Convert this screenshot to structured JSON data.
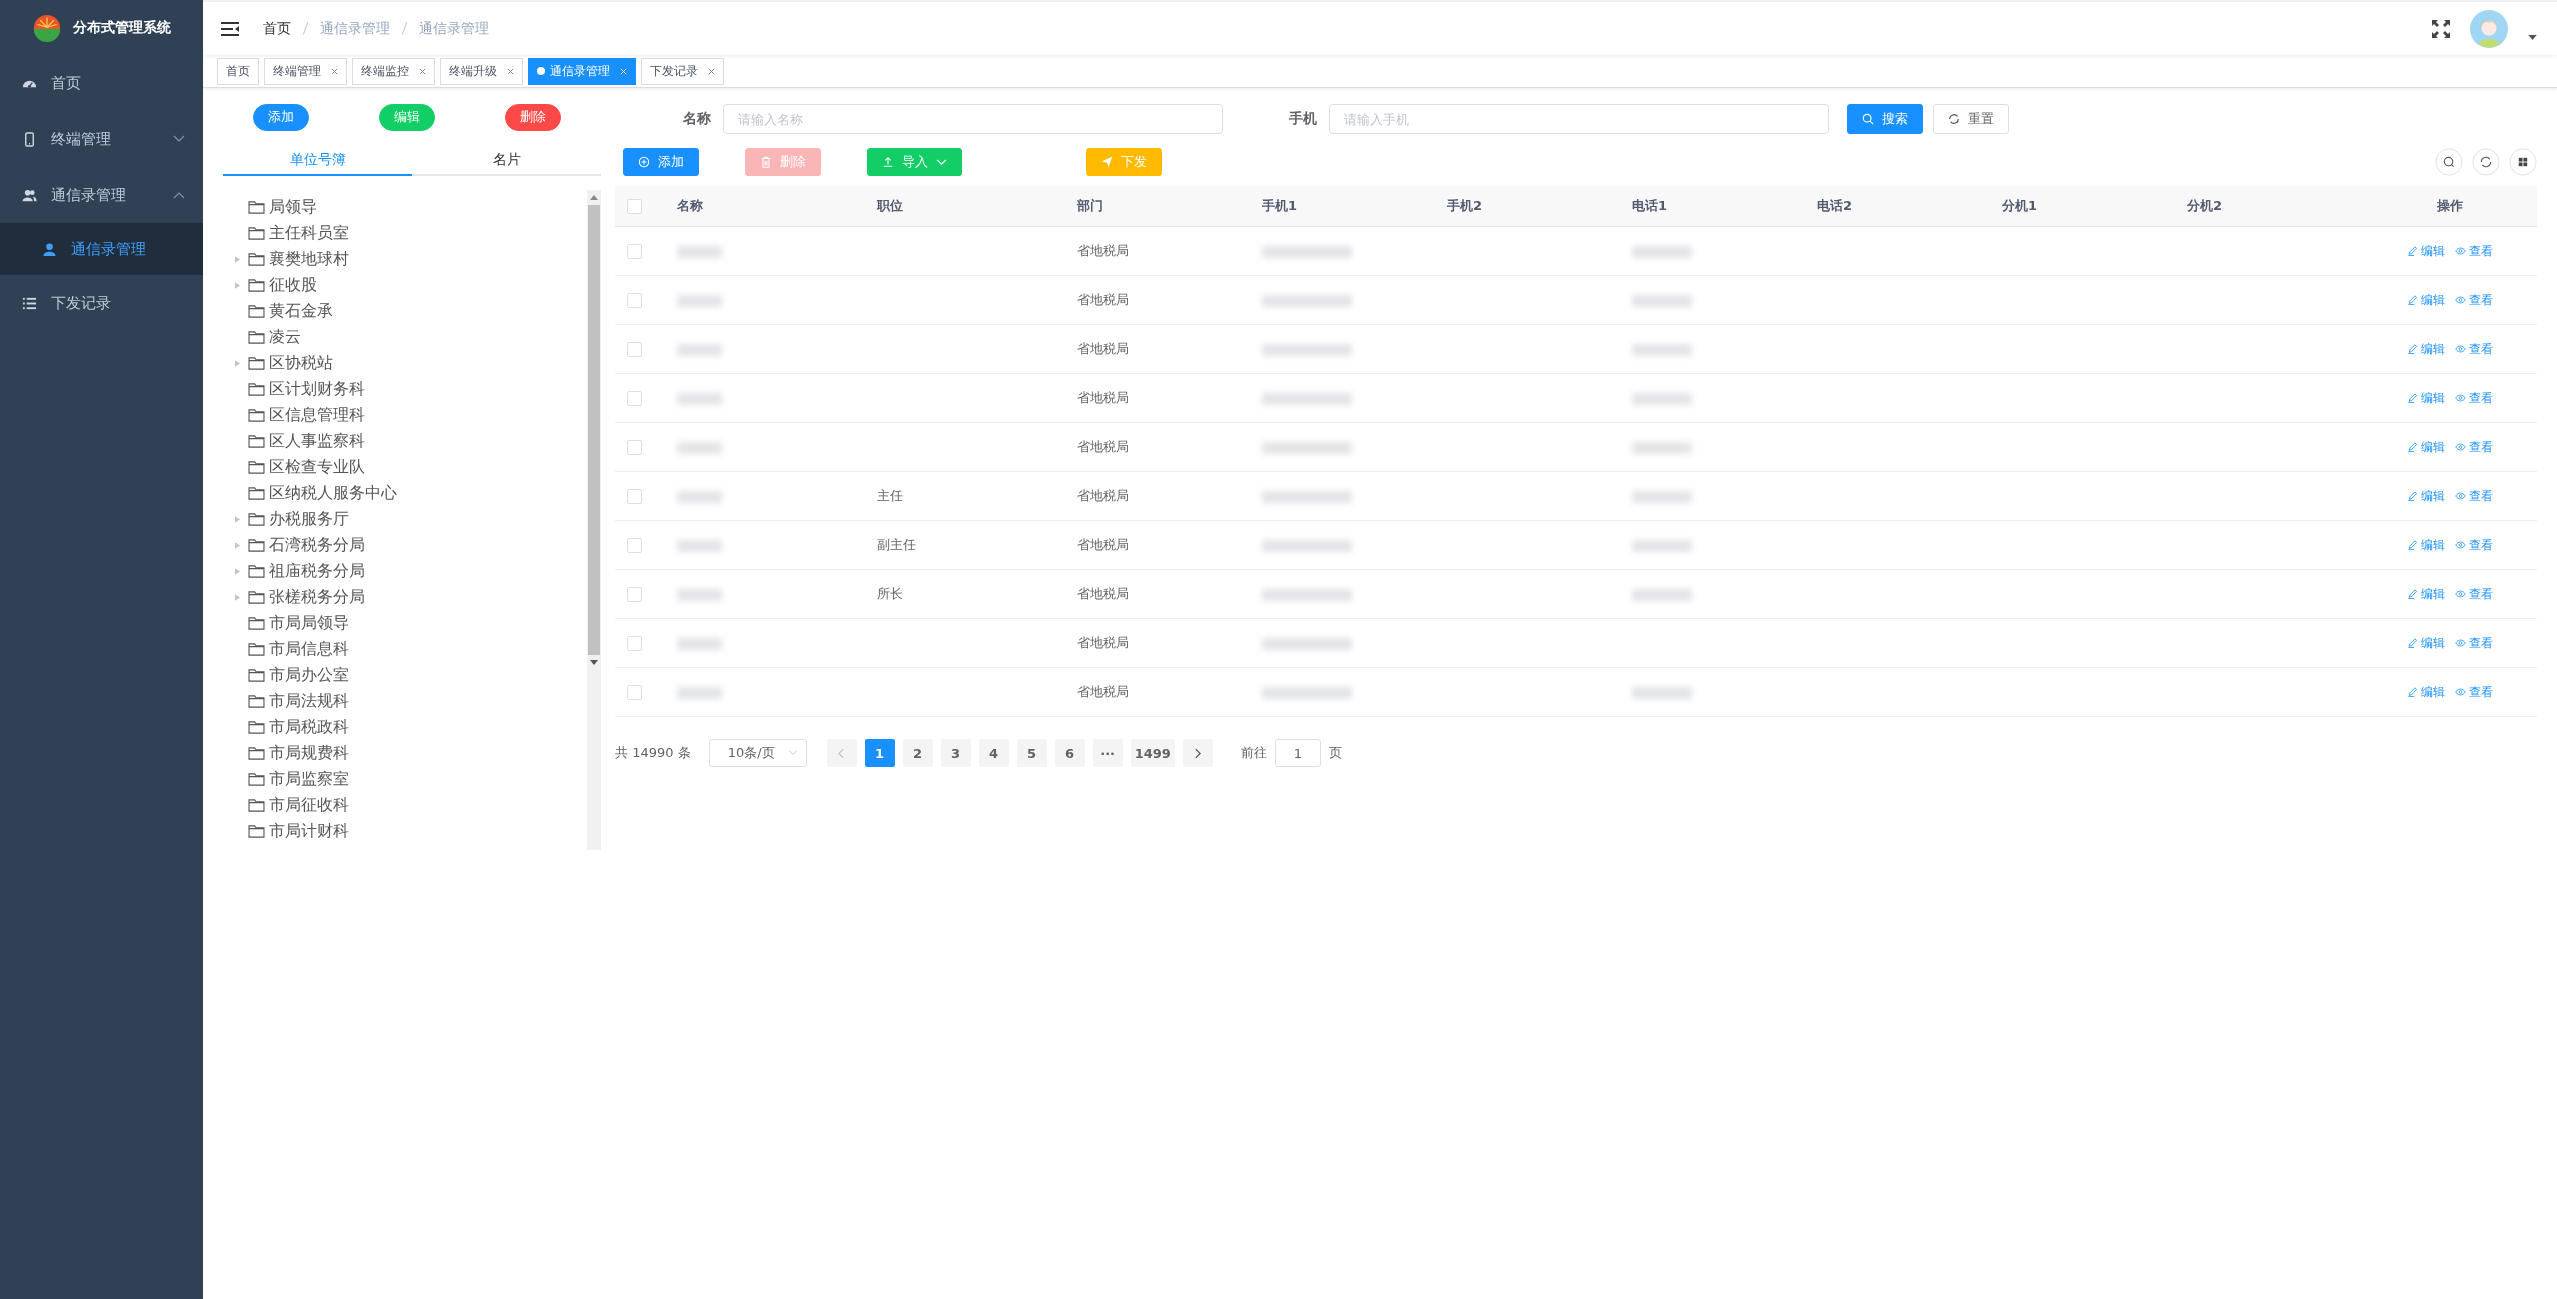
{
  "sidebar": {
    "title": "分布式管理系统",
    "items": [
      {
        "label": "首页",
        "selected": false
      },
      {
        "label": "终端管理",
        "expanded": false,
        "selected": false
      },
      {
        "label": "通信录管理",
        "expanded": true,
        "selected": false,
        "children": [
          {
            "label": "通信录管理",
            "selected": true
          }
        ]
      },
      {
        "label": "下发记录",
        "selected": false
      }
    ]
  },
  "breadcrumb": [
    "首页",
    "通信录管理",
    "通信录管理"
  ],
  "tabs": [
    {
      "label": "首页",
      "selected": false,
      "closable": false
    },
    {
      "label": "终端管理",
      "selected": false,
      "closable": true
    },
    {
      "label": "终端监控",
      "selected": false,
      "closable": true
    },
    {
      "label": "终端升级",
      "selected": false,
      "closable": true
    },
    {
      "label": "通信录管理",
      "selected": true,
      "closable": true
    },
    {
      "label": "下发记录",
      "selected": false,
      "closable": true
    }
  ],
  "left_panel": {
    "buttons": [
      {
        "label": "添加",
        "kind": "primary"
      },
      {
        "label": "编辑",
        "kind": "success"
      },
      {
        "label": "删除",
        "kind": "danger"
      }
    ],
    "tabs": [
      {
        "label": "单位号簿",
        "selected": true
      },
      {
        "label": "名片",
        "selected": false
      }
    ],
    "tree": [
      {
        "label": "局领导",
        "expandable": false
      },
      {
        "label": "主任科员室",
        "expandable": false
      },
      {
        "label": "襄樊地球村",
        "expandable": true
      },
      {
        "label": "征收股",
        "expandable": true
      },
      {
        "label": "黄石金承",
        "expandable": false
      },
      {
        "label": "凌云",
        "expandable": false
      },
      {
        "label": "区协税站",
        "expandable": true
      },
      {
        "label": "区计划财务科",
        "expandable": false
      },
      {
        "label": "区信息管理科",
        "expandable": false
      },
      {
        "label": "区人事监察科",
        "expandable": false
      },
      {
        "label": "区检查专业队",
        "expandable": false
      },
      {
        "label": "区纳税人服务中心",
        "expandable": false
      },
      {
        "label": "办税服务厅",
        "expandable": true
      },
      {
        "label": "石湾税务分局",
        "expandable": true
      },
      {
        "label": "祖庙税务分局",
        "expandable": true
      },
      {
        "label": "张槎税务分局",
        "expandable": true
      },
      {
        "label": "市局局领导",
        "expandable": false
      },
      {
        "label": "市局信息科",
        "expandable": false
      },
      {
        "label": "市局办公室",
        "expandable": false
      },
      {
        "label": "市局法规科",
        "expandable": false
      },
      {
        "label": "市局税政科",
        "expandable": false
      },
      {
        "label": "市局规费科",
        "expandable": false
      },
      {
        "label": "市局监察室",
        "expandable": false
      },
      {
        "label": "市局征收科",
        "expandable": false
      },
      {
        "label": "市局计财科",
        "expandable": false
      }
    ]
  },
  "search": {
    "fields": [
      {
        "label": "名称",
        "placeholder": "请输入名称"
      },
      {
        "label": "手机",
        "placeholder": "请输入手机"
      }
    ],
    "search_button": "搜索",
    "reset_button": "重置"
  },
  "toolbar": [
    {
      "label": "添加",
      "kind": "primary",
      "disabled": false
    },
    {
      "label": "删除",
      "kind": "danger",
      "disabled": true
    },
    {
      "label": "导入",
      "kind": "success",
      "disabled": false
    },
    {
      "label": "下发",
      "kind": "warning",
      "disabled": false
    }
  ],
  "table": {
    "select_all_checked": false,
    "columns": [
      "名称",
      "职位",
      "部门",
      "手机1",
      "手机2",
      "电话1",
      "电话2",
      "分机1",
      "分机2",
      "操作"
    ],
    "rows": [
      {
        "checked": false,
        "position": "",
        "department": "省地税局",
        "has_tel1": true,
        "actions": [
          "编辑",
          "查看"
        ]
      },
      {
        "checked": false,
        "position": "",
        "department": "省地税局",
        "has_tel1": true,
        "actions": [
          "编辑",
          "查看"
        ]
      },
      {
        "checked": false,
        "position": "",
        "department": "省地税局",
        "has_tel1": true,
        "actions": [
          "编辑",
          "查看"
        ]
      },
      {
        "checked": false,
        "position": "",
        "department": "省地税局",
        "has_tel1": true,
        "actions": [
          "编辑",
          "查看"
        ]
      },
      {
        "checked": false,
        "position": "",
        "department": "省地税局",
        "has_tel1": true,
        "actions": [
          "编辑",
          "查看"
        ]
      },
      {
        "checked": false,
        "position": "主任",
        "department": "省地税局",
        "has_tel1": true,
        "actions": [
          "编辑",
          "查看"
        ]
      },
      {
        "checked": false,
        "position": "副主任",
        "department": "省地税局",
        "has_tel1": true,
        "actions": [
          "编辑",
          "查看"
        ]
      },
      {
        "checked": false,
        "position": "所长",
        "department": "省地税局",
        "has_tel1": true,
        "actions": [
          "编辑",
          "查看"
        ]
      },
      {
        "checked": false,
        "position": "",
        "department": "省地税局",
        "has_tel1": false,
        "actions": [
          "编辑",
          "查看"
        ]
      },
      {
        "checked": false,
        "position": "",
        "department": "省地税局",
        "has_tel1": true,
        "actions": [
          "编辑",
          "查看"
        ]
      }
    ]
  },
  "pagination": {
    "total": "共 14990 条",
    "page_size": "10条/页",
    "pages": [
      {
        "label": "1",
        "selected": true
      },
      {
        "label": "2",
        "selected": false
      },
      {
        "label": "3",
        "selected": false
      },
      {
        "label": "4",
        "selected": false
      },
      {
        "label": "5",
        "selected": false
      },
      {
        "label": "6",
        "selected": false
      },
      {
        "label": "···",
        "selected": false
      },
      {
        "label": "1499",
        "selected": false
      }
    ],
    "goto_label": "前往",
    "goto_value": "1",
    "goto_suffix": "页"
  }
}
